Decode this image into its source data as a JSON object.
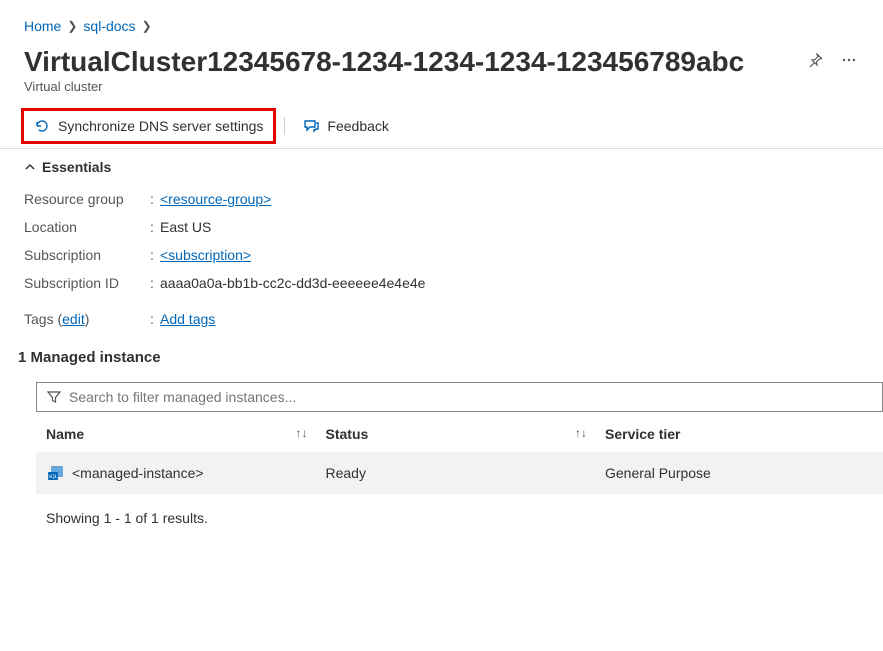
{
  "breadcrumb": {
    "home": "Home",
    "parent": "sql-docs"
  },
  "page": {
    "title": "VirtualCluster12345678-1234-1234-1234-123456789abc",
    "subtitle": "Virtual cluster"
  },
  "toolbar": {
    "sync_dns": "Synchronize DNS server settings",
    "feedback": "Feedback"
  },
  "essentials": {
    "header": "Essentials",
    "rows": {
      "resource_group_label": "Resource group",
      "resource_group_value": "<resource-group>",
      "location_label": "Location",
      "location_value": "East US",
      "subscription_label": "Subscription",
      "subscription_value": "<subscription>",
      "subscription_id_label": "Subscription ID",
      "subscription_id_value": "aaaa0a0a-bb1b-cc2c-dd3d-eeeeee4e4e4e",
      "tags_label": "Tags",
      "tags_edit": "edit",
      "tags_action": "Add tags"
    }
  },
  "managed_instance": {
    "section_title": "1 Managed instance",
    "search_placeholder": "Search to filter managed instances...",
    "columns": {
      "name": "Name",
      "status": "Status",
      "tier": "Service tier"
    },
    "row": {
      "name": "<managed-instance>",
      "status": "Ready",
      "tier": "General Purpose"
    },
    "results_text": "Showing 1 - 1 of 1 results."
  }
}
